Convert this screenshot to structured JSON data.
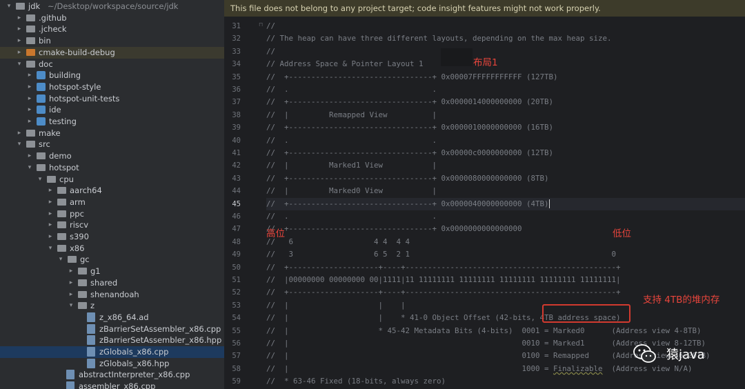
{
  "project_tree": {
    "root_label": "jdk",
    "root_path": "~/Desktop/workspace/source/jdk",
    "items": [
      {
        "label": "jdk",
        "indent": 0,
        "type": "folder",
        "expanded": true
      },
      {
        "label": ".github",
        "indent": 1,
        "type": "folder",
        "expanded": false
      },
      {
        "label": ".jcheck",
        "indent": 1,
        "type": "folder",
        "expanded": false
      },
      {
        "label": "bin",
        "indent": 1,
        "type": "folder",
        "expanded": false
      },
      {
        "label": "cmake-build-debug",
        "indent": 1,
        "type": "folder-orange",
        "expanded": false
      },
      {
        "label": "doc",
        "indent": 1,
        "type": "folder",
        "expanded": true
      },
      {
        "label": "building",
        "indent": 2,
        "type": "module",
        "expanded": false
      },
      {
        "label": "hotspot-style",
        "indent": 2,
        "type": "module",
        "expanded": false
      },
      {
        "label": "hotspot-unit-tests",
        "indent": 2,
        "type": "module",
        "expanded": false
      },
      {
        "label": "ide",
        "indent": 2,
        "type": "module",
        "expanded": false
      },
      {
        "label": "testing",
        "indent": 2,
        "type": "module",
        "expanded": false
      },
      {
        "label": "make",
        "indent": 1,
        "type": "folder",
        "expanded": false
      },
      {
        "label": "src",
        "indent": 1,
        "type": "folder",
        "expanded": true
      },
      {
        "label": "demo",
        "indent": 2,
        "type": "folder",
        "expanded": false
      },
      {
        "label": "hotspot",
        "indent": 2,
        "type": "folder",
        "expanded": true
      },
      {
        "label": "cpu",
        "indent": 3,
        "type": "folder",
        "expanded": true
      },
      {
        "label": "aarch64",
        "indent": 4,
        "type": "folder",
        "expanded": false
      },
      {
        "label": "arm",
        "indent": 4,
        "type": "folder",
        "expanded": false
      },
      {
        "label": "ppc",
        "indent": 4,
        "type": "folder",
        "expanded": false
      },
      {
        "label": "riscv",
        "indent": 4,
        "type": "folder",
        "expanded": false
      },
      {
        "label": "s390",
        "indent": 4,
        "type": "folder",
        "expanded": false
      },
      {
        "label": "x86",
        "indent": 4,
        "type": "folder",
        "expanded": true
      },
      {
        "label": "gc",
        "indent": 5,
        "type": "folder",
        "expanded": true
      },
      {
        "label": "g1",
        "indent": 6,
        "type": "folder",
        "expanded": false
      },
      {
        "label": "shared",
        "indent": 6,
        "type": "folder",
        "expanded": false
      },
      {
        "label": "shenandoah",
        "indent": 6,
        "type": "folder",
        "expanded": false
      },
      {
        "label": "z",
        "indent": 6,
        "type": "folder",
        "expanded": true
      },
      {
        "label": "z_x86_64.ad",
        "indent": 7,
        "type": "file"
      },
      {
        "label": "zBarrierSetAssembler_x86.cpp",
        "indent": 7,
        "type": "file"
      },
      {
        "label": "zBarrierSetAssembler_x86.hpp",
        "indent": 7,
        "type": "file"
      },
      {
        "label": "zGlobals_x86.cpp",
        "indent": 7,
        "type": "file",
        "selected": true
      },
      {
        "label": "zGlobals_x86.hpp",
        "indent": 7,
        "type": "file"
      },
      {
        "label": "abstractInterpreter_x86.cpp",
        "indent": 5,
        "type": "file"
      },
      {
        "label": "assembler_x86.cpp",
        "indent": 5,
        "type": "file"
      }
    ]
  },
  "editor": {
    "banner": "This file does not belong to any project target; code insight features might not work properly.",
    "current_line": 45,
    "lines": [
      {
        "n": 31,
        "text": "//"
      },
      {
        "n": 32,
        "text": "// The heap can have three different layouts, depending on the max heap size."
      },
      {
        "n": 33,
        "text": "//"
      },
      {
        "n": 34,
        "text": "// Address Space & Pointer Layout 1"
      },
      {
        "n": 35,
        "text": "//  +--------------------------------+ 0x00007FFFFFFFFFFF (127TB)"
      },
      {
        "n": 36,
        "text": "//  .                                ."
      },
      {
        "n": 37,
        "text": "//  +--------------------------------+ 0x0000014000000000 (20TB)"
      },
      {
        "n": 38,
        "text": "//  |         Remapped View          |"
      },
      {
        "n": 39,
        "text": "//  +--------------------------------+ 0x0000010000000000 (16TB)"
      },
      {
        "n": 40,
        "text": "//  .                                ."
      },
      {
        "n": 41,
        "text": "//  +--------------------------------+ 0x00000c0000000000 (12TB)"
      },
      {
        "n": 42,
        "text": "//  |         Marked1 View           |"
      },
      {
        "n": 43,
        "text": "//  +--------------------------------+ 0x0000080000000000 (8TB)"
      },
      {
        "n": 44,
        "text": "//  |         Marked0 View           |"
      },
      {
        "n": 45,
        "text": "//  +--------------------------------+ 0x0000040000000000 (4TB)"
      },
      {
        "n": 46,
        "text": "//  .                                ."
      },
      {
        "n": 47,
        "text": "//  +--------------------------------+ 0x0000000000000000"
      },
      {
        "n": 48,
        "text": "//   6                  4 4  4 4                                           "
      },
      {
        "n": 49,
        "text": "//   3                  6 5  2 1                                             0"
      },
      {
        "n": 50,
        "text": "//  +--------------------+----+-----------------------------------------------+"
      },
      {
        "n": 51,
        "text": "//  |00000000 00000000 00|1111|11 11111111 11111111 11111111 11111111 11111111|"
      },
      {
        "n": 52,
        "text": "//  +--------------------+----+-----------------------------------------------+"
      },
      {
        "n": 53,
        "text": "//  |                    |    |"
      },
      {
        "n": 54,
        "text": "//  |                    |    * 41-0 Object Offset (42-bits, 4TB address space)"
      },
      {
        "n": 55,
        "text": "//  |                    * 45-42 Metadata Bits (4-bits)  0001 = Marked0      (Address view 4-8TB)"
      },
      {
        "n": 56,
        "text": "//  |                                                    0010 = Marked1      (Address view 8-12TB)"
      },
      {
        "n": 57,
        "text": "//  |                                                    0100 = Remapped     (Address view 16-20TB)"
      },
      {
        "n": 58,
        "text": "//  |                                                    1000 = Finalizable  (Address view N/A)"
      },
      {
        "n": 59,
        "text": "//  * 63-46 Fixed (18-bits, always zero)"
      }
    ]
  },
  "annotations": {
    "layout_label": "布局1",
    "high_bit": "高位",
    "low_bit": "低位",
    "support_note": "支持 4TB的堆内存"
  },
  "watermark": {
    "text": "猿java"
  },
  "colors": {
    "annotation_red": "#e8453c",
    "banner_bg": "#3d3b2a",
    "selected_row": "#1d3a5e",
    "highlight_row": "#3b3a2f"
  }
}
